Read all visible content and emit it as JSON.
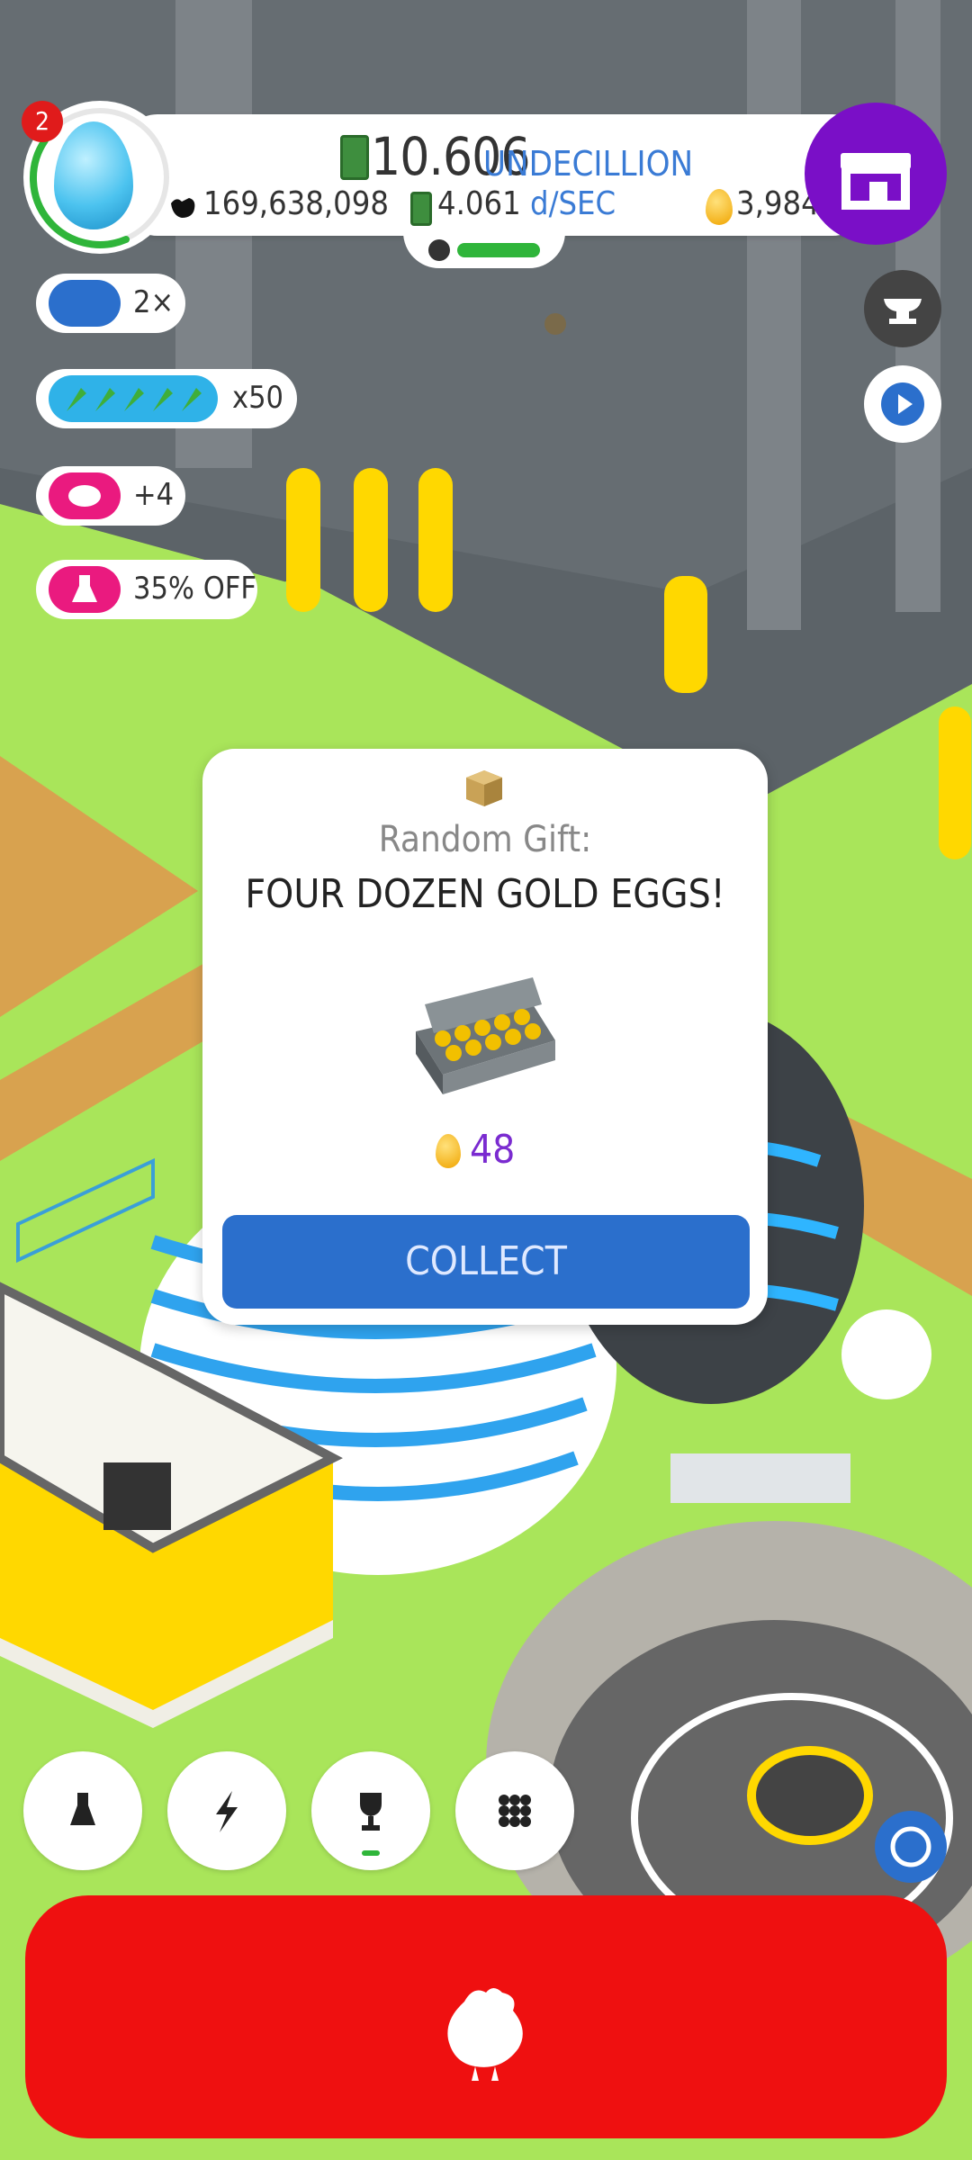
{
  "header": {
    "notification_count": "2",
    "money_value": "10.606",
    "money_unit": "UNDECILLION",
    "chicken_count": "169,638,098",
    "earn_rate_value": "4.061",
    "earn_rate_unit": "d/SEC",
    "golden_eggs": "3,984"
  },
  "boosts": [
    {
      "label": "2×",
      "icon": "tv-icon",
      "color": "#2b6fcc"
    },
    {
      "label": "x50",
      "icon": "rocket-icon",
      "color": "#2fb2e8"
    },
    {
      "label": "+4",
      "icon": "piggy-bank-icon",
      "color": "#ea1a7f"
    },
    {
      "label": "35% OFF",
      "icon": "flask-icon",
      "color": "#ea1a7f"
    }
  ],
  "popup": {
    "subtitle": "Random Gift:",
    "title": "FOUR DOZEN GOLD EGGS!",
    "reward_amount": "48",
    "collect_label": "COLLECT"
  },
  "bottom_nav": [
    {
      "name": "research",
      "icon": "flask-icon"
    },
    {
      "name": "boosts",
      "icon": "lightning-icon"
    },
    {
      "name": "achievements",
      "icon": "trophy-icon"
    },
    {
      "name": "menu",
      "icon": "grid-icon"
    }
  ],
  "colors": {
    "shop": "#7a0fc7",
    "collect": "#2b6fcc",
    "chicken_button": "#ef1010",
    "grass": "#a9e55a"
  }
}
